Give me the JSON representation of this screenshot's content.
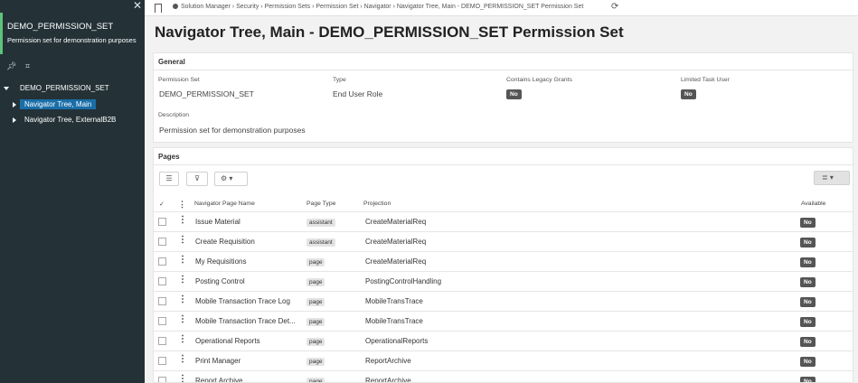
{
  "sidebar": {
    "title": "DEMO_PERMISSION_SET",
    "subtitle": "Permission set for demonstration purposes",
    "close_glyph": "✕",
    "tool_icons": [
      "pin-icon",
      "grid-icon"
    ],
    "tree_root": "DEMO_PERMISSION_SET",
    "tree_items": [
      {
        "label": "Navigator Tree, Main"
      },
      {
        "label": "Navigator Tree, ExternalB2B"
      }
    ]
  },
  "breadcrumb": {
    "items": [
      "Solution Manager",
      "Security",
      "Permission Sets",
      "Permission Set",
      "Navigator",
      "Navigator Tree, Main - DEMO_PERMISSION_SET Permission Set"
    ],
    "text": "Solution Manager › Security › Permission Sets › Permission Set › Navigator › Navigator Tree, Main - DEMO_PERMISSION_SET Permission Set"
  },
  "page_title": "Navigator Tree, Main - DEMO_PERMISSION_SET Permission Set",
  "general": {
    "header": "General",
    "permission_set_label": "Permission Set",
    "permission_set_value": "DEMO_PERMISSION_SET",
    "type_label": "Type",
    "type_value": "End User Role",
    "legacy_label": "Contains Legacy Grants",
    "legacy_value": "No",
    "limited_label": "Limited Task User",
    "limited_value": "No",
    "description_label": "Description",
    "description_value": "Permission set for demonstration purposes"
  },
  "pages": {
    "header": "Pages",
    "columns": {
      "name": "Navigator Page Name",
      "type": "Page Type",
      "projection": "Projection",
      "available": "Available"
    },
    "rows": [
      {
        "name": "Issue Material",
        "type": "assistant",
        "projection": "CreateMaterialReq",
        "available": "No"
      },
      {
        "name": "Create Requisition",
        "type": "assistant",
        "projection": "CreateMaterialReq",
        "available": "No"
      },
      {
        "name": "My Requisitions",
        "type": "page",
        "projection": "CreateMaterialReq",
        "available": "No"
      },
      {
        "name": "Posting Control",
        "type": "page",
        "projection": "PostingControlHandling",
        "available": "No"
      },
      {
        "name": "Mobile Transaction Trace Log",
        "type": "page",
        "projection": "MobileTransTrace",
        "available": "No"
      },
      {
        "name": "Mobile Transaction Trace Det...",
        "type": "page",
        "projection": "MobileTransTrace",
        "available": "No"
      },
      {
        "name": "Operational Reports",
        "type": "page",
        "projection": "OperationalReports",
        "available": "No"
      },
      {
        "name": "Print Manager",
        "type": "page",
        "projection": "ReportArchive",
        "available": "No"
      },
      {
        "name": "Report Archive",
        "type": "page",
        "projection": "ReportArchive",
        "available": "No"
      }
    ]
  },
  "colors": {
    "sidebar_bg": "#243238",
    "accent": "#5ec27a",
    "selected": "#1a6ea8"
  }
}
